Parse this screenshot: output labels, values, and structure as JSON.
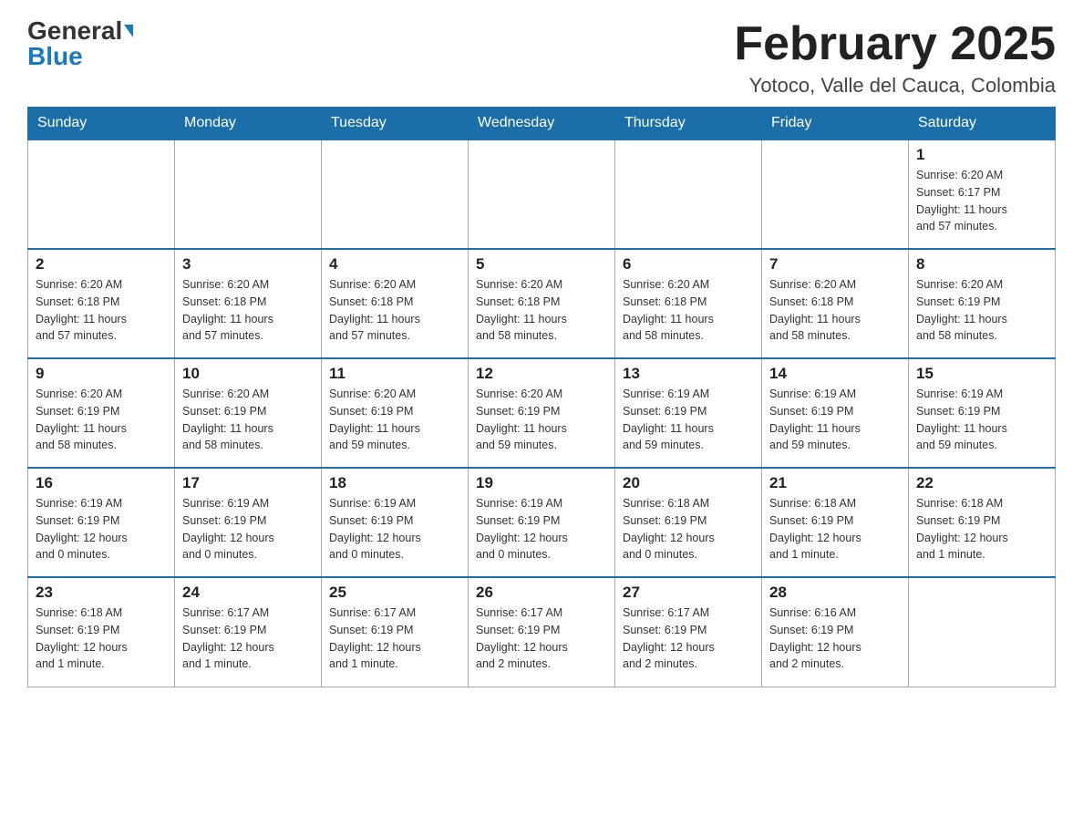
{
  "logo": {
    "general": "General",
    "blue": "Blue"
  },
  "header": {
    "month": "February 2025",
    "location": "Yotoco, Valle del Cauca, Colombia"
  },
  "days_of_week": [
    "Sunday",
    "Monday",
    "Tuesday",
    "Wednesday",
    "Thursday",
    "Friday",
    "Saturday"
  ],
  "weeks": [
    [
      {
        "day": "",
        "info": ""
      },
      {
        "day": "",
        "info": ""
      },
      {
        "day": "",
        "info": ""
      },
      {
        "day": "",
        "info": ""
      },
      {
        "day": "",
        "info": ""
      },
      {
        "day": "",
        "info": ""
      },
      {
        "day": "1",
        "info": "Sunrise: 6:20 AM\nSunset: 6:17 PM\nDaylight: 11 hours\nand 57 minutes."
      }
    ],
    [
      {
        "day": "2",
        "info": "Sunrise: 6:20 AM\nSunset: 6:18 PM\nDaylight: 11 hours\nand 57 minutes."
      },
      {
        "day": "3",
        "info": "Sunrise: 6:20 AM\nSunset: 6:18 PM\nDaylight: 11 hours\nand 57 minutes."
      },
      {
        "day": "4",
        "info": "Sunrise: 6:20 AM\nSunset: 6:18 PM\nDaylight: 11 hours\nand 57 minutes."
      },
      {
        "day": "5",
        "info": "Sunrise: 6:20 AM\nSunset: 6:18 PM\nDaylight: 11 hours\nand 58 minutes."
      },
      {
        "day": "6",
        "info": "Sunrise: 6:20 AM\nSunset: 6:18 PM\nDaylight: 11 hours\nand 58 minutes."
      },
      {
        "day": "7",
        "info": "Sunrise: 6:20 AM\nSunset: 6:18 PM\nDaylight: 11 hours\nand 58 minutes."
      },
      {
        "day": "8",
        "info": "Sunrise: 6:20 AM\nSunset: 6:19 PM\nDaylight: 11 hours\nand 58 minutes."
      }
    ],
    [
      {
        "day": "9",
        "info": "Sunrise: 6:20 AM\nSunset: 6:19 PM\nDaylight: 11 hours\nand 58 minutes."
      },
      {
        "day": "10",
        "info": "Sunrise: 6:20 AM\nSunset: 6:19 PM\nDaylight: 11 hours\nand 58 minutes."
      },
      {
        "day": "11",
        "info": "Sunrise: 6:20 AM\nSunset: 6:19 PM\nDaylight: 11 hours\nand 59 minutes."
      },
      {
        "day": "12",
        "info": "Sunrise: 6:20 AM\nSunset: 6:19 PM\nDaylight: 11 hours\nand 59 minutes."
      },
      {
        "day": "13",
        "info": "Sunrise: 6:19 AM\nSunset: 6:19 PM\nDaylight: 11 hours\nand 59 minutes."
      },
      {
        "day": "14",
        "info": "Sunrise: 6:19 AM\nSunset: 6:19 PM\nDaylight: 11 hours\nand 59 minutes."
      },
      {
        "day": "15",
        "info": "Sunrise: 6:19 AM\nSunset: 6:19 PM\nDaylight: 11 hours\nand 59 minutes."
      }
    ],
    [
      {
        "day": "16",
        "info": "Sunrise: 6:19 AM\nSunset: 6:19 PM\nDaylight: 12 hours\nand 0 minutes."
      },
      {
        "day": "17",
        "info": "Sunrise: 6:19 AM\nSunset: 6:19 PM\nDaylight: 12 hours\nand 0 minutes."
      },
      {
        "day": "18",
        "info": "Sunrise: 6:19 AM\nSunset: 6:19 PM\nDaylight: 12 hours\nand 0 minutes."
      },
      {
        "day": "19",
        "info": "Sunrise: 6:19 AM\nSunset: 6:19 PM\nDaylight: 12 hours\nand 0 minutes."
      },
      {
        "day": "20",
        "info": "Sunrise: 6:18 AM\nSunset: 6:19 PM\nDaylight: 12 hours\nand 0 minutes."
      },
      {
        "day": "21",
        "info": "Sunrise: 6:18 AM\nSunset: 6:19 PM\nDaylight: 12 hours\nand 1 minute."
      },
      {
        "day": "22",
        "info": "Sunrise: 6:18 AM\nSunset: 6:19 PM\nDaylight: 12 hours\nand 1 minute."
      }
    ],
    [
      {
        "day": "23",
        "info": "Sunrise: 6:18 AM\nSunset: 6:19 PM\nDaylight: 12 hours\nand 1 minute."
      },
      {
        "day": "24",
        "info": "Sunrise: 6:17 AM\nSunset: 6:19 PM\nDaylight: 12 hours\nand 1 minute."
      },
      {
        "day": "25",
        "info": "Sunrise: 6:17 AM\nSunset: 6:19 PM\nDaylight: 12 hours\nand 1 minute."
      },
      {
        "day": "26",
        "info": "Sunrise: 6:17 AM\nSunset: 6:19 PM\nDaylight: 12 hours\nand 2 minutes."
      },
      {
        "day": "27",
        "info": "Sunrise: 6:17 AM\nSunset: 6:19 PM\nDaylight: 12 hours\nand 2 minutes."
      },
      {
        "day": "28",
        "info": "Sunrise: 6:16 AM\nSunset: 6:19 PM\nDaylight: 12 hours\nand 2 minutes."
      },
      {
        "day": "",
        "info": ""
      }
    ]
  ]
}
